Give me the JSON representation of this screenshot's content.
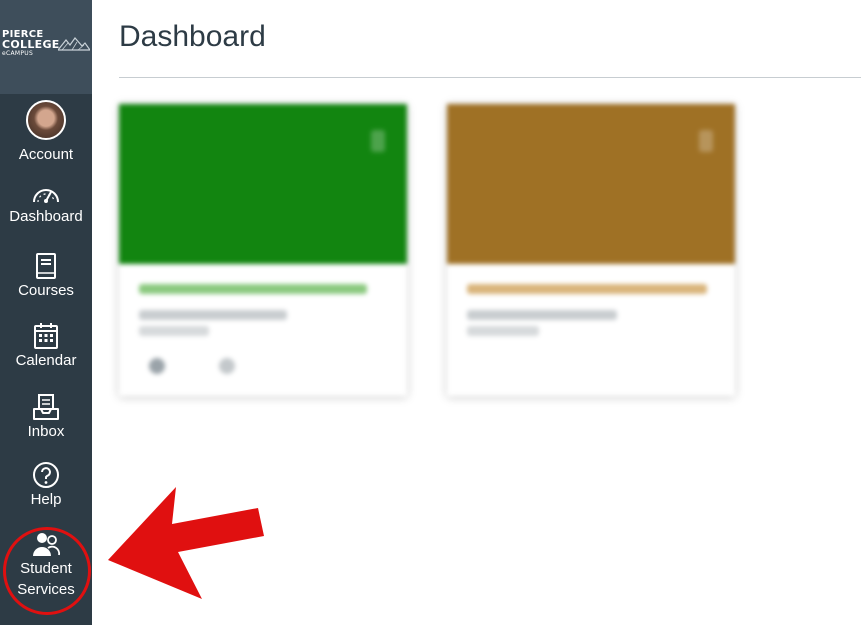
{
  "logo": {
    "line1": "PIERCE",
    "line2": "COLLEGE",
    "line3": "eCAMPUS"
  },
  "nav": {
    "items": [
      {
        "label": "Account",
        "icon": "avatar"
      },
      {
        "label": "Dashboard",
        "icon": "dashboard-icon"
      },
      {
        "label": "Courses",
        "icon": "courses-book-icon"
      },
      {
        "label": "Calendar",
        "icon": "calendar-icon"
      },
      {
        "label": "Inbox",
        "icon": "inbox-icon"
      },
      {
        "label": "Help",
        "icon": "help-icon"
      },
      {
        "label_line1": "Student",
        "label_line2": "Services",
        "icon": "student-services-icon"
      }
    ]
  },
  "main": {
    "title": "Dashboard"
  },
  "cards": [
    {
      "color": "#128510",
      "title_color": "#8ac97e"
    },
    {
      "color": "#9f7125",
      "title_color": "#d9b47a"
    }
  ],
  "colors": {
    "nav_bg": "#2d3b45",
    "annotation_red": "#e01010"
  }
}
